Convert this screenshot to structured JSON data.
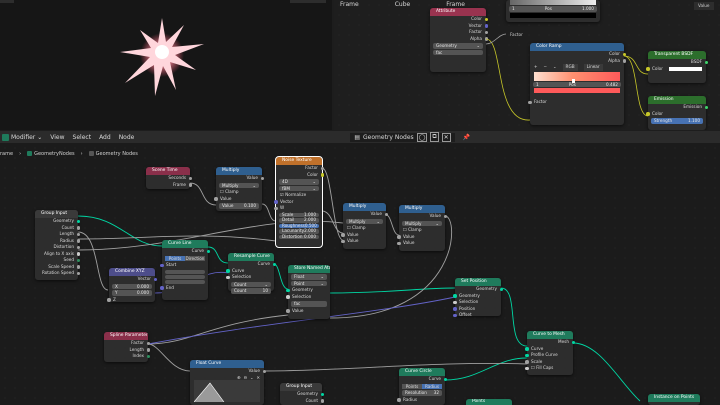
{
  "colors": {
    "attr": "#99334f",
    "geo": "#1f7b5c",
    "tex": "#c0712b",
    "math": "#2f5f8f",
    "input": "#8a2f4a",
    "shader": "#2c6e2c",
    "vec": "#6363c7",
    "float": "#a1a1a1",
    "color": "#c7c729",
    "bool": "#ccc",
    "accent": "#4772b3"
  },
  "topbar": {
    "frame_left": "Frame",
    "cube": "Cube",
    "frame_right": "Frame"
  },
  "top_nodes": {
    "ramp_top": {
      "field_num": "1",
      "field_label": "Pos",
      "field_val": "1.000"
    },
    "attribute": {
      "title": "Attribute",
      "outs": [
        "Color",
        "Vector",
        "Factor",
        "Alpha"
      ],
      "dropdown": "Geometry",
      "name": "fac"
    },
    "color_ramp": {
      "title": "Color Ramp",
      "outs": [
        "Color",
        "Alpha"
      ],
      "mode": "RGB",
      "interp": "Linear",
      "idx": "1",
      "pos_label": "Pos",
      "pos_val": "0.482",
      "in": "Factor"
    },
    "transparent": {
      "title": "Transparent BSDF",
      "out": "BSDF",
      "in": "Color"
    },
    "emission": {
      "title": "Emission",
      "out": "Emission",
      "in1": "Color",
      "in2": "Strength",
      "strength": "1.100"
    },
    "value_label": "Value",
    "factor_label": "Factor"
  },
  "header": {
    "editor": "Modifier",
    "menus": [
      "View",
      "Select",
      "Add",
      "Node"
    ],
    "tree_name": "Geometry Nodes",
    "crumb": [
      "rame",
      "GeometryNodes",
      "Geometry Nodes"
    ]
  },
  "nodes": {
    "group_input": {
      "title": "Group Input",
      "outs": [
        "Geometry",
        "Count",
        "Length",
        "Radius",
        "Distortion",
        "Align to X axis",
        "Seed",
        "Scale Speed",
        "Rotation Speed"
      ]
    },
    "scene_time": {
      "title": "Scene Time",
      "outs": [
        "Seconds",
        "Frame"
      ]
    },
    "multiply1": {
      "title": "Multiply",
      "out": "Value",
      "op": "Multiply",
      "clamp": "Clamp",
      "in": "Value",
      "val_label": "Value",
      "val": "0.100"
    },
    "noise": {
      "title": "Noise Texture",
      "outs": [
        "Factor",
        "Color"
      ],
      "dim": "4D",
      "type": "fBM",
      "normalize": "Normalize",
      "ins": [
        "Vector",
        "W"
      ],
      "fields": [
        [
          "Scale",
          "1.000"
        ],
        [
          "Detail",
          "2.000"
        ],
        [
          "Roughness",
          "0.500"
        ],
        [
          "Lacunarity",
          "2.000"
        ],
        [
          "Distortion",
          "0.000"
        ]
      ]
    },
    "multiply2": {
      "title": "Multiply",
      "out": "Value",
      "op": "Multiply",
      "clamp": "Clamp",
      "ins": [
        "Value",
        "Value"
      ]
    },
    "multiply3": {
      "title": "Multiply",
      "out": "Value",
      "op": "Multiply",
      "clamp": "Clamp",
      "ins": [
        "Value",
        "Value"
      ]
    },
    "curve_line": {
      "title": "Curve Line",
      "out": "Curve",
      "modes": [
        "Points",
        "Direction"
      ],
      "start": "Start",
      "end": "End"
    },
    "combine_xyz": {
      "title": "Combine XYZ",
      "out": "Vector",
      "fields": [
        [
          "X",
          "0.000"
        ],
        [
          "Y",
          "0.000"
        ]
      ],
      "in": "Z"
    },
    "resample": {
      "title": "Resample Curve",
      "out": "Curve",
      "ins": [
        "Curve",
        "Selection"
      ],
      "mode": "Count",
      "count_label": "Count",
      "count": "10"
    },
    "store_attr": {
      "title": "Store Named Attri...",
      "out": "Geometry",
      "type": "Float",
      "domain": "Point",
      "ins": [
        "Geometry",
        "Selection",
        "fac",
        "Value"
      ]
    },
    "set_position": {
      "title": "Set Position",
      "out": "Geometry",
      "ins": [
        "Geometry",
        "Selection",
        "Position",
        "Offset"
      ]
    },
    "spline_param": {
      "title": "Spline Parameter",
      "outs": [
        "Factor",
        "Length",
        "Index"
      ]
    },
    "float_curve": {
      "title": "Float Curve",
      "out": "Value"
    },
    "curve_to_mesh": {
      "title": "Curve to Mesh",
      "out": "Mesh",
      "ins": [
        "Curve",
        "Profile Curve",
        "Scale",
        "Fill Caps"
      ]
    },
    "curve_circle": {
      "title": "Curve Circle",
      "out": "Curve",
      "modes": [
        "Points",
        "Radius"
      ],
      "res_label": "Resolution",
      "res": "32",
      "in": "Radius"
    },
    "group_input2": {
      "title": "Group Input",
      "outs": [
        "Geometry",
        "Count"
      ]
    },
    "points": {
      "title": "Points"
    },
    "instance_points": {
      "title": "Instance on Points"
    }
  }
}
